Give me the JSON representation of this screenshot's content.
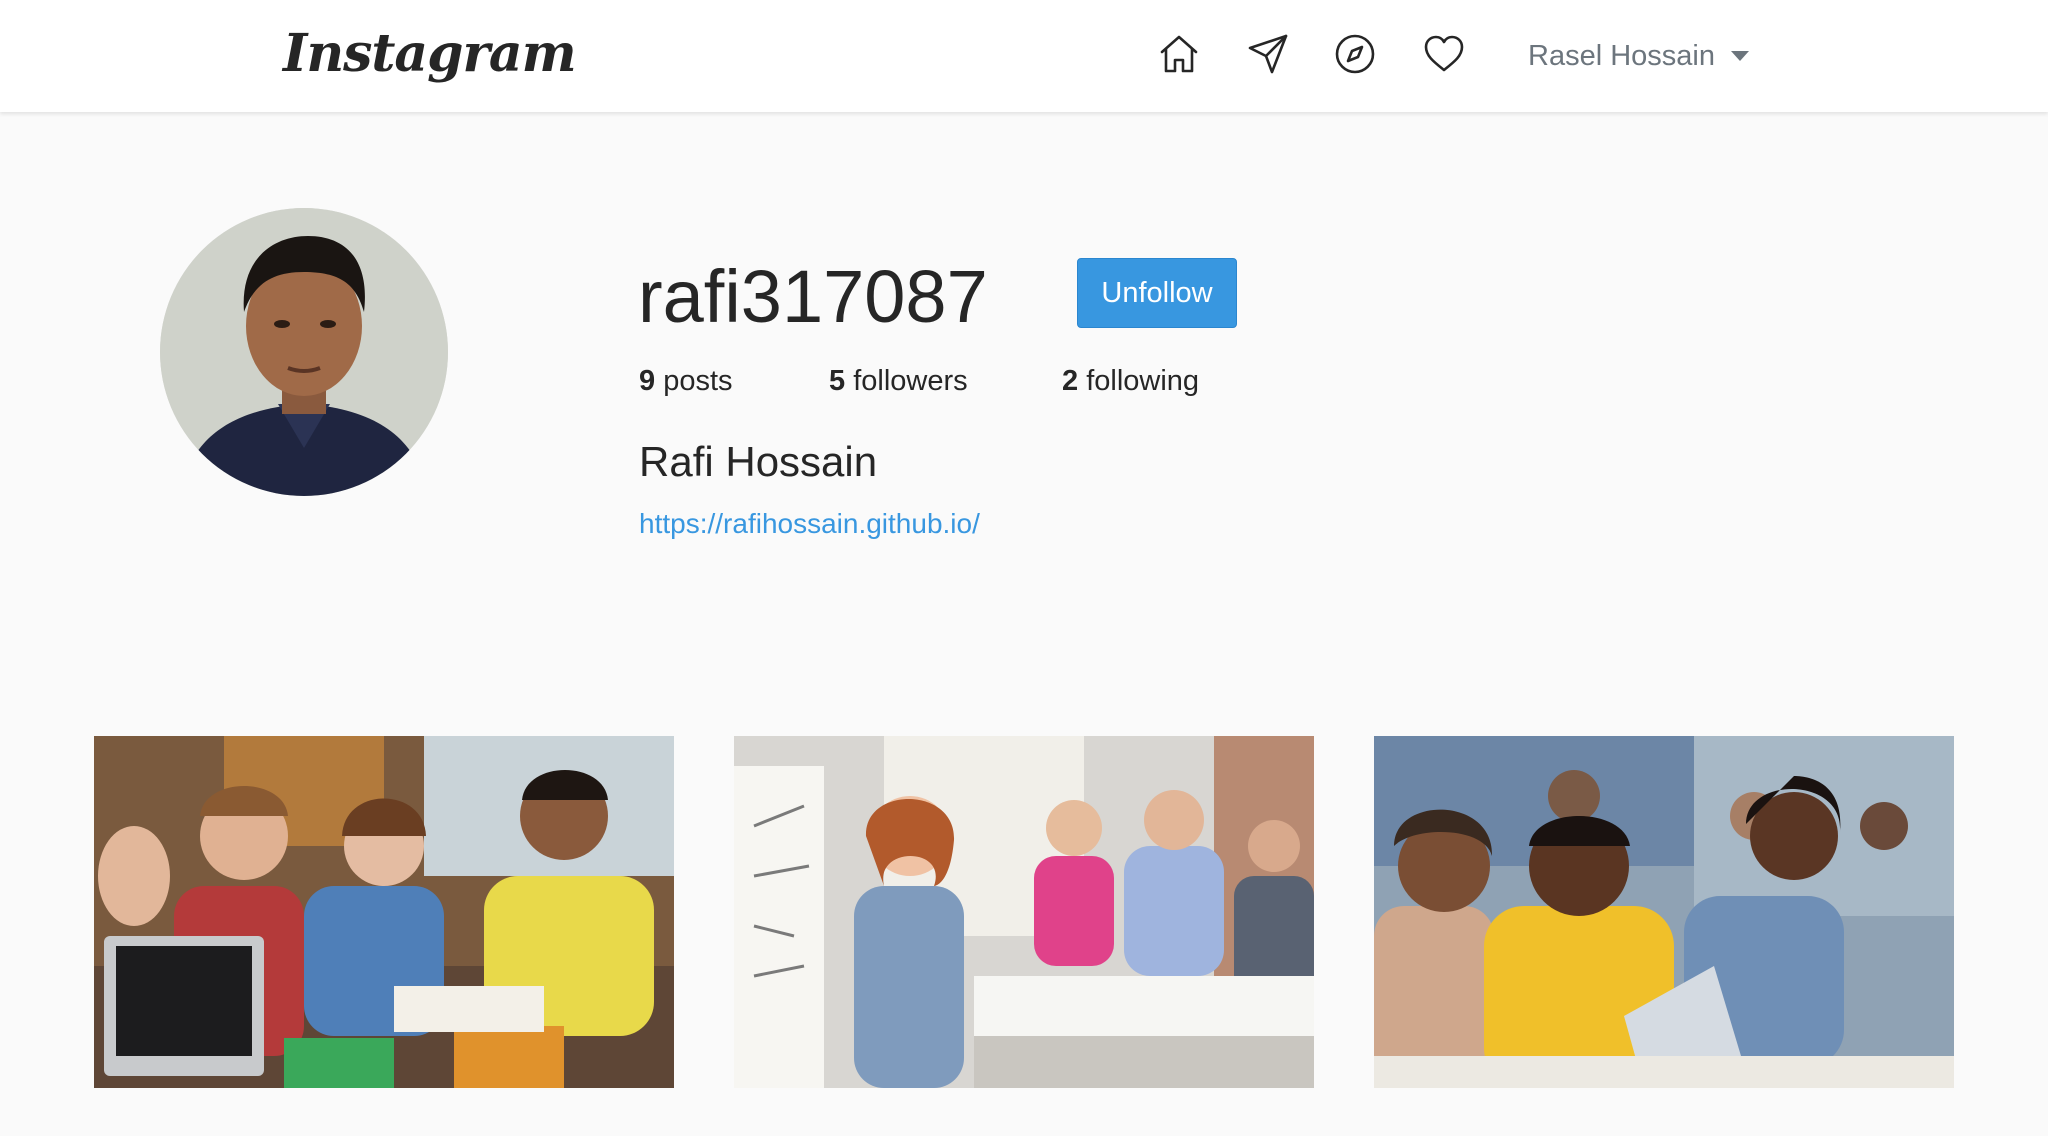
{
  "nav": {
    "logo_text": "Instagram",
    "icons": [
      "home-icon",
      "paper-plane-icon",
      "compass-icon",
      "heart-icon"
    ],
    "user_menu_label": "Rasel Hossain"
  },
  "profile": {
    "username": "rafi317087",
    "follow_button_label": "Unfollow",
    "stats": [
      {
        "count": "9",
        "label": "posts"
      },
      {
        "count": "5",
        "label": "followers"
      },
      {
        "count": "2",
        "label": "following"
      }
    ],
    "full_name": "Rafi Hossain",
    "website": "https://rafihossain.github.io/"
  },
  "posts": [
    {
      "description": "students-group-study-photo"
    },
    {
      "description": "office-whiteboard-presentation-photo"
    },
    {
      "description": "students-laptop-classroom-photo"
    }
  ],
  "colors": {
    "accent": "#3897e0",
    "background": "#fafafa",
    "navbar": "#ffffff",
    "text": "#262626",
    "muted": "#6c757d"
  }
}
